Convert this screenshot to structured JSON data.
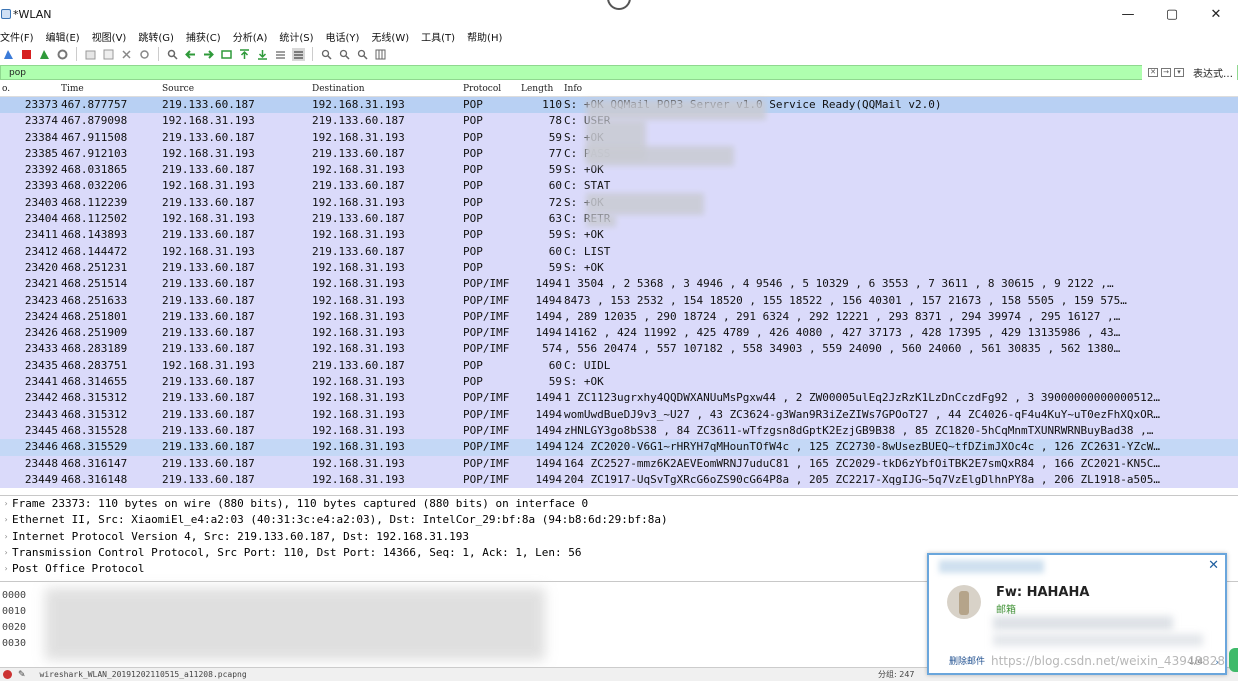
{
  "window": {
    "title": "*WLAN",
    "controls": [
      "—",
      "▢",
      "✕"
    ]
  },
  "menu": [
    "文件(F)",
    "编辑(E)",
    "视图(V)",
    "跳转(G)",
    "捕获(C)",
    "分析(A)",
    "统计(S)",
    "电话(Y)",
    "无线(W)",
    "工具(T)",
    "帮助(H)"
  ],
  "filter": {
    "value": "pop",
    "expression_label": "表达式…"
  },
  "columns": {
    "no": "o.",
    "time": "Time",
    "source": "Source",
    "destination": "Destination",
    "protocol": "Protocol",
    "length": "Length",
    "info": "Info"
  },
  "packets": [
    {
      "no": "23373",
      "time": "467.877757",
      "src": "219.133.60.187",
      "dst": "192.168.31.193",
      "proto": "POP",
      "len": "110",
      "info": "S: +OK QQMail POP3 Server v1.0 Service Ready(QQMail v2.0)"
    },
    {
      "no": "23374",
      "time": "467.879098",
      "src": "192.168.31.193",
      "dst": "219.133.60.187",
      "proto": "POP",
      "len": "78",
      "info": "C: USER"
    },
    {
      "no": "23384",
      "time": "467.911508",
      "src": "219.133.60.187",
      "dst": "192.168.31.193",
      "proto": "POP",
      "len": "59",
      "info": "S: +OK"
    },
    {
      "no": "23385",
      "time": "467.912103",
      "src": "192.168.31.193",
      "dst": "219.133.60.187",
      "proto": "POP",
      "len": "77",
      "info": "C: PASS"
    },
    {
      "no": "23392",
      "time": "468.031865",
      "src": "219.133.60.187",
      "dst": "192.168.31.193",
      "proto": "POP",
      "len": "59",
      "info": "S: +OK"
    },
    {
      "no": "23393",
      "time": "468.032206",
      "src": "192.168.31.193",
      "dst": "219.133.60.187",
      "proto": "POP",
      "len": "60",
      "info": "C: STAT"
    },
    {
      "no": "23403",
      "time": "468.112239",
      "src": "219.133.60.187",
      "dst": "192.168.31.193",
      "proto": "POP",
      "len": "72",
      "info": "S: +OK"
    },
    {
      "no": "23404",
      "time": "468.112502",
      "src": "192.168.31.193",
      "dst": "219.133.60.187",
      "proto": "POP",
      "len": "63",
      "info": "C: RETR"
    },
    {
      "no": "23411",
      "time": "468.143893",
      "src": "219.133.60.187",
      "dst": "192.168.31.193",
      "proto": "POP",
      "len": "59",
      "info": "S: +OK"
    },
    {
      "no": "23412",
      "time": "468.144472",
      "src": "192.168.31.193",
      "dst": "219.133.60.187",
      "proto": "POP",
      "len": "60",
      "info": "C: LIST"
    },
    {
      "no": "23420",
      "time": "468.251231",
      "src": "219.133.60.187",
      "dst": "192.168.31.193",
      "proto": "POP",
      "len": "59",
      "info": "S: +OK"
    },
    {
      "no": "23421",
      "time": "468.251514",
      "src": "219.133.60.187",
      "dst": "192.168.31.193",
      "proto": "POP/IMF",
      "len": "1494",
      "info": "1 3504  , 2 5368  , 3 4946  , 4 9546  , 5 10329  , 6 3553  , 7 3611  , 8 30615  , 9 2122  ,…"
    },
    {
      "no": "23423",
      "time": "468.251633",
      "src": "219.133.60.187",
      "dst": "192.168.31.193",
      "proto": "POP/IMF",
      "len": "1494",
      "info": "8473  , 153 2532  , 154 18520  , 155 18522  , 156 40301  , 157 21673  , 158 5505  , 159 575…"
    },
    {
      "no": "23424",
      "time": "468.251801",
      "src": "219.133.60.187",
      "dst": "192.168.31.193",
      "proto": "POP/IMF",
      "len": "1494",
      "info": ", 289 12035  , 290 18724  , 291 6324  , 292 12221  , 293 8371  , 294 39974  , 295 16127  ,…"
    },
    {
      "no": "23426",
      "time": "468.251909",
      "src": "219.133.60.187",
      "dst": "192.168.31.193",
      "proto": "POP/IMF",
      "len": "1494",
      "info": "14162  , 424 11992  , 425 4789  , 426 4080  , 427 37173  , 428 17395  , 429 13135986  , 43…"
    },
    {
      "no": "23433",
      "time": "468.283189",
      "src": "219.133.60.187",
      "dst": "192.168.31.193",
      "proto": "POP/IMF",
      "len": "574",
      "info": ", 556 20474  , 557 107182  , 558 34903  , 559 24090  , 560 24060  , 561 30835  , 562 1380…"
    },
    {
      "no": "23435",
      "time": "468.283751",
      "src": "192.168.31.193",
      "dst": "219.133.60.187",
      "proto": "POP",
      "len": "60",
      "info": "C: UIDL"
    },
    {
      "no": "23441",
      "time": "468.314655",
      "src": "219.133.60.187",
      "dst": "192.168.31.193",
      "proto": "POP",
      "len": "59",
      "info": "S: +OK"
    },
    {
      "no": "23442",
      "time": "468.315312",
      "src": "219.133.60.187",
      "dst": "192.168.31.193",
      "proto": "POP/IMF",
      "len": "1494",
      "info": "1 ZC1123ugrxhy4QQDWXANUuMsPgxw44  , 2 ZW00005ulEq2JzRzK1LzDnCczdFg92  , 3 39000000000000512…"
    },
    {
      "no": "23443",
      "time": "468.315312",
      "src": "219.133.60.187",
      "dst": "192.168.31.193",
      "proto": "POP/IMF",
      "len": "1494",
      "info": "womUwdBueDJ9v3_~U27  , 43 ZC3624-g3Wan9R3iZeZIWs7GPOoT27  , 44 ZC4026-qF4u4KuY~uT0ezFhXQxOR…"
    },
    {
      "no": "23445",
      "time": "468.315528",
      "src": "219.133.60.187",
      "dst": "192.168.31.193",
      "proto": "POP/IMF",
      "len": "1494",
      "info": "zHNLGY3go8bS38  , 84 ZC3611-wTfzgsn8dGptK2EzjGB9B38  , 85 ZC1820-5hCqMnmTXUNRWRNBuyBad38  ,…"
    },
    {
      "no": "23446",
      "time": "468.315529",
      "src": "219.133.60.187",
      "dst": "192.168.31.193",
      "proto": "POP/IMF",
      "len": "1494",
      "info": "124 ZC2020-V6G1~rHRYH7qMHounTOfW4c  , 125 ZC2730-8wUsezBUEQ~tfDZimJXOc4c  , 126 ZC2631-YZcW…"
    },
    {
      "no": "23448",
      "time": "468.316147",
      "src": "219.133.60.187",
      "dst": "192.168.31.193",
      "proto": "POP/IMF",
      "len": "1494",
      "info": "164 ZC2527-mmz6K2AEVEomWRNJ7uduC81  , 165 ZC2029-tkD6zYbfOiTBK2E7smQxR84  , 166 ZC2021-KN5C…"
    },
    {
      "no": "23449",
      "time": "468.316148",
      "src": "219.133.60.187",
      "dst": "192.168.31.193",
      "proto": "POP/IMF",
      "len": "1494",
      "info": "204 ZC1917-UqSvTgXRcG6oZS90cG64P8a  , 205 ZC2217-XqgIJG~5q7VzElgDlhnPY8a  , 206 ZL1918-a505…"
    }
  ],
  "details": [
    "Frame 23373: 110 bytes on wire (880 bits), 110 bytes captured (880 bits) on interface 0",
    "Ethernet II, Src: XiaomiEl_e4:a2:03 (40:31:3c:e4:a2:03), Dst: IntelCor_29:bf:8a (94:b8:6d:29:bf:8a)",
    "Internet Protocol Version 4, Src: 219.133.60.187, Dst: 192.168.31.193",
    "Transmission Control Protocol, Src Port: 110, Dst Port: 14366, Seq: 1, Ack: 1, Len: 56",
    "Post Office Protocol"
  ],
  "bytes": {
    "offsets": [
      "0000",
      "0010",
      "0020",
      "0030"
    ]
  },
  "status": {
    "file": "wireshark_WLAN_20191202110515_a11208.pcapng",
    "packets": "分组: 247"
  },
  "notification": {
    "subject": "Fw: HAHAHA",
    "tag": "邮箱",
    "footer": "删除邮件",
    "page": "1/4"
  },
  "watermark": "https://blog.csdn.net/weixin_43948828"
}
